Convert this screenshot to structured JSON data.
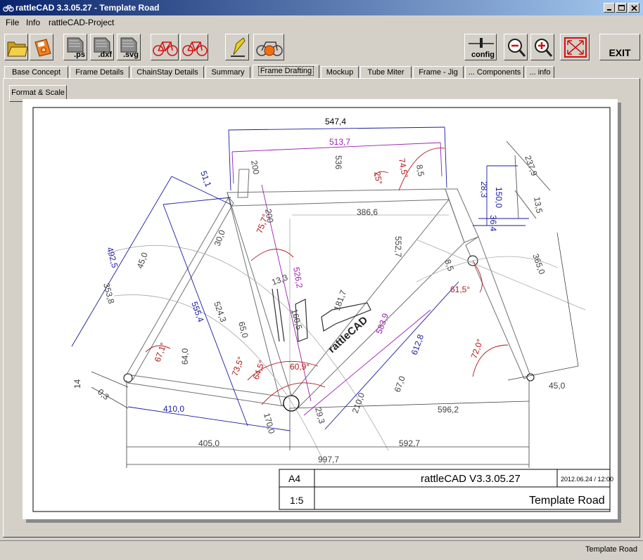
{
  "window": {
    "title": "rattleCAD  3.3.05.27 - Template Road"
  },
  "menu": {
    "items": [
      {
        "label": "File"
      },
      {
        "label": "Info"
      },
      {
        "label": "rattleCAD-Project"
      }
    ]
  },
  "toolbar": {
    "ps_label": ".ps",
    "dxf_label": ".dxf",
    "svg_label": ".svg",
    "config_label": "config",
    "exit_label": "EXIT"
  },
  "tabs": [
    {
      "label": "Base Concept"
    },
    {
      "label": "Frame Details"
    },
    {
      "label": "ChainStay Details"
    },
    {
      "label": "Summary"
    },
    {
      "label": "Frame Drafting"
    },
    {
      "label": "Mockup"
    },
    {
      "label": "Tube Miter"
    },
    {
      "label": "Frame - Jig"
    },
    {
      "label": "... Components"
    },
    {
      "label": "... info"
    }
  ],
  "active_tab": "Frame Drafting",
  "format_scale_label": "Format & Scale",
  "drawing": {
    "dimensions": [
      "547,4",
      "513,7",
      "536",
      "200",
      "200",
      "25°",
      "74,5°",
      "8,5",
      "28,3",
      "150,0",
      "237,9",
      "13,5",
      "36,4",
      "51,1",
      "386,6",
      "75,7°",
      "552,7",
      "492,5",
      "30,0",
      "45,0",
      "353,8",
      "526,2",
      "365,0",
      "8,5",
      "61,5°",
      "555,4",
      "524,3",
      "13,3",
      "160,5",
      "181,7",
      "65,0",
      "583,9",
      "612,8",
      "67,1°",
      "64,0",
      "72,0°",
      "73,5°",
      "64,5°",
      "60,9°",
      "14",
      "0,3",
      "170,0",
      "29,3",
      "210,0",
      "67,0",
      "410,0",
      "596,2",
      "45,0",
      "405,0",
      "592,7",
      "997,7"
    ],
    "down_tube_decal": "rattleCAD",
    "title_block": {
      "format": "A4",
      "software": "rattleCAD    V3.3.05.27",
      "date": "2012.06.24 / 12:00",
      "scale": "1:5",
      "project": "Template Road"
    }
  },
  "status": {
    "text": "Template Road"
  },
  "colors": {
    "dimension_blue": "#1a1aa0",
    "dimension_purple": "#9b1fb0",
    "angle_red": "#b01818",
    "frame_gray": "#707070"
  }
}
